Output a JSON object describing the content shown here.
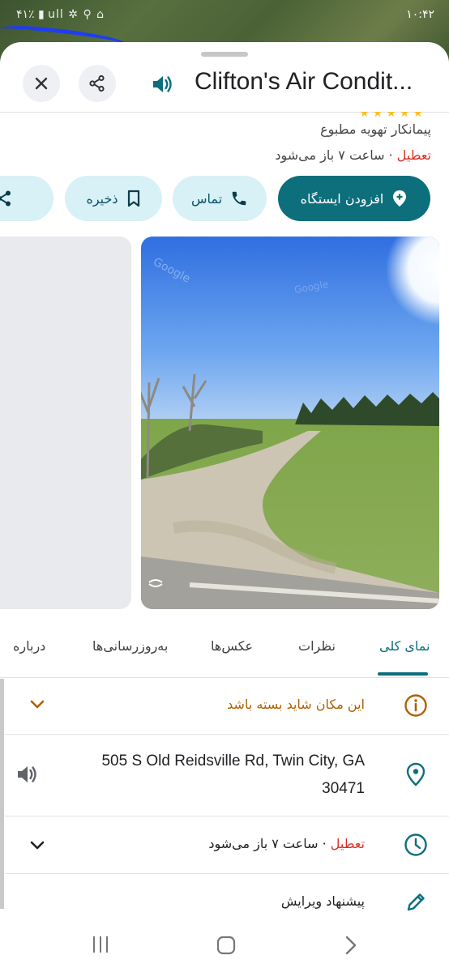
{
  "status_bar": {
    "time": "۱۰:۴۲",
    "left_indicators": "۴۱٪ ▮ ull ✲ ⚲ ⌂"
  },
  "place": {
    "title": "Clifton's Air Condit...",
    "rating_stars": "★★★★★",
    "category": "پیمانکار تهویه مطبوع",
    "closed_label": "تعطیل",
    "open_info": " · ساعت ۷ باز می‌شود"
  },
  "actions": {
    "add_stop": "افزودن ایستگاه",
    "call": "تماس",
    "save": "ذخیره",
    "share_partial": "اش"
  },
  "tabs": {
    "overview": "نمای کلی",
    "reviews": "نظرات",
    "photos": "عکس‌ها",
    "updates": "به‌روزرسانی‌ها",
    "about": "درباره"
  },
  "info": {
    "maybe_closed": "این مکان شاید بسته باشد",
    "address": "505 S Old Reidsville Rd, Twin City, GA 30471",
    "hours_closed": "تعطیل",
    "hours_open": " · ساعت ۷ باز می‌شود",
    "suggest_edit": "پیشنهاد ویرایش"
  },
  "colors": {
    "accent": "#0d6e7c",
    "chip_bg": "#d7f1f6",
    "closed_red": "#d93025",
    "warning_brown": "#b06000"
  }
}
